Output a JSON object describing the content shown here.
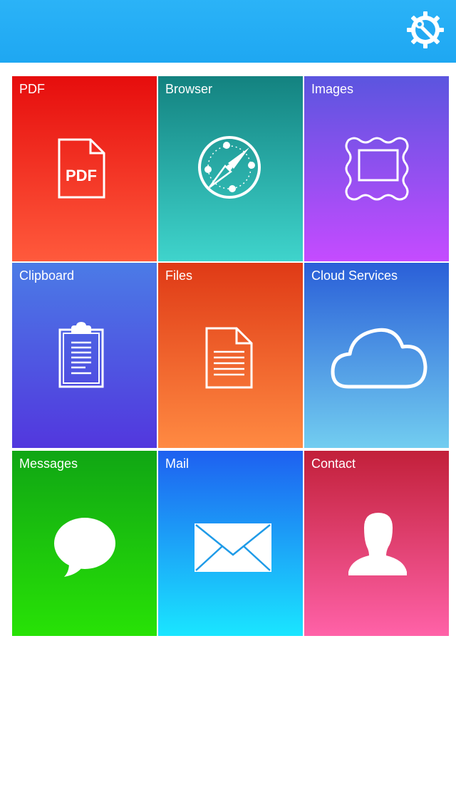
{
  "header": {
    "settings_icon": "settings-wrench-gear-icon",
    "background_color": "#1ea7f2"
  },
  "tiles": [
    {
      "label": "PDF",
      "icon": "pdf-document-icon"
    },
    {
      "label": "Browser",
      "icon": "compass-icon"
    },
    {
      "label": "Images",
      "icon": "picture-frame-icon"
    },
    {
      "label": "Clipboard",
      "icon": "clipboard-icon"
    },
    {
      "label": "Files",
      "icon": "file-document-icon"
    },
    {
      "label": "Cloud Services",
      "icon": "cloud-icon"
    },
    {
      "label": "Messages",
      "icon": "speech-bubble-icon"
    },
    {
      "label": "Mail",
      "icon": "envelope-icon"
    },
    {
      "label": "Contact",
      "icon": "person-silhouette-icon"
    }
  ],
  "pdf_icon_text": "PDF"
}
